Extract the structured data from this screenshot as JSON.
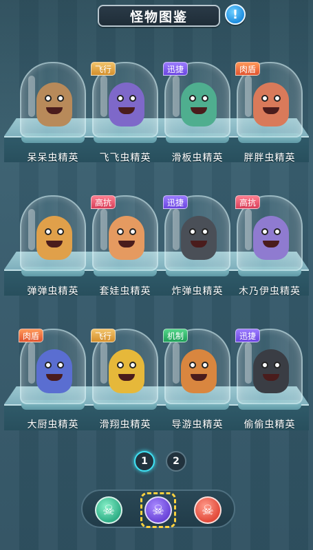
{
  "header": {
    "title": "怪物图鉴",
    "info_icon": "info-icon"
  },
  "colors": {
    "background": "#3b5f6f",
    "active_page": "#3fe0f2",
    "tab_selected": "#ffd23f"
  },
  "rows": [
    [
      {
        "name": "呆呆虫精英",
        "tag": "",
        "tag_type": "",
        "body": "#b88a5a"
      },
      {
        "name": "飞飞虫精英",
        "tag": "飞行",
        "tag_type": "fly",
        "body": "#7e68c9"
      },
      {
        "name": "滑板虫精英",
        "tag": "迅捷",
        "tag_type": "fast",
        "body": "#4fae8f"
      },
      {
        "name": "胖胖虫精英",
        "tag": "肉盾",
        "tag_type": "tank",
        "body": "#d97a5a"
      }
    ],
    [
      {
        "name": "弹弹虫精英",
        "tag": "",
        "tag_type": "",
        "body": "#e0a04a"
      },
      {
        "name": "套娃虫精英",
        "tag": "高抗",
        "tag_type": "resist",
        "body": "#e59a60"
      },
      {
        "name": "炸弹虫精英",
        "tag": "迅捷",
        "tag_type": "fast",
        "body": "#4a4f57"
      },
      {
        "name": "木乃伊虫精英",
        "tag": "高抗",
        "tag_type": "resist",
        "body": "#8f7bd0"
      }
    ],
    [
      {
        "name": "大厨虫精英",
        "tag": "肉盾",
        "tag_type": "tank",
        "body": "#5a6ed1"
      },
      {
        "name": "滑翔虫精英",
        "tag": "飞行",
        "tag_type": "fly",
        "body": "#e6b83a"
      },
      {
        "name": "导游虫精英",
        "tag": "机制",
        "tag_type": "mech",
        "body": "#d9863f"
      },
      {
        "name": "偷偷虫精英",
        "tag": "迅捷",
        "tag_type": "fast",
        "body": "#3a3d44"
      }
    ]
  ],
  "pager": {
    "pages": [
      "1",
      "2"
    ],
    "active": "1"
  },
  "tabs": [
    {
      "icon": "skull-icon",
      "glyph": "☠"
    },
    {
      "icon": "skull-crossbones-icon",
      "glyph": "☠"
    },
    {
      "icon": "boss-skull-icon",
      "glyph": "☠"
    }
  ]
}
